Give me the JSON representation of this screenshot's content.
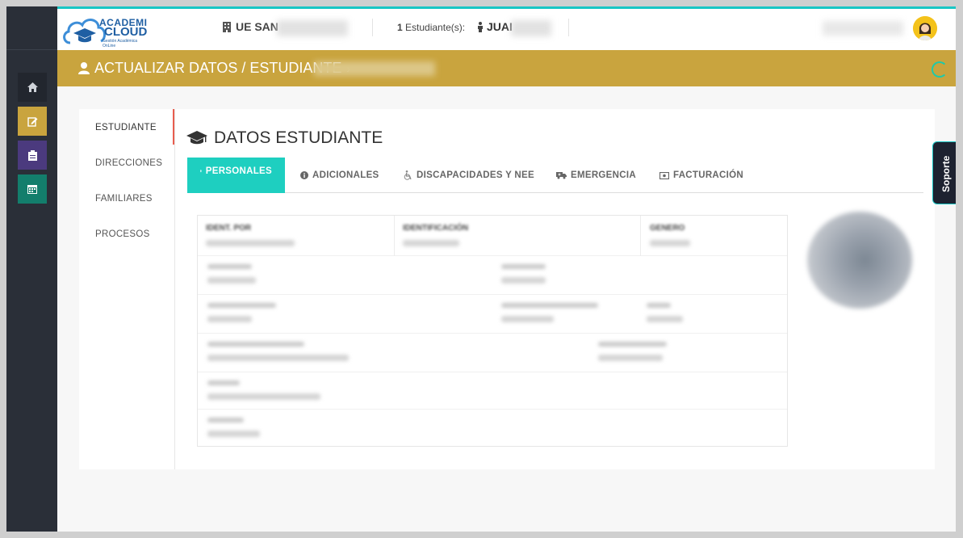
{
  "header": {
    "logo_line1": "ACADEMI",
    "logo_line2": "CLOUD",
    "logo_sub": "Gestión Académica OnLine",
    "school_name": "UE SAN",
    "student_count_number": "1",
    "student_count_label": "Estudiante(s):",
    "student_name": "JUAI"
  },
  "titlebar": {
    "title": "ACTUALIZAR DATOS / ESTUDIANTE",
    "separator": "›"
  },
  "left_nav": {
    "items": [
      {
        "label": "ESTUDIANTE"
      },
      {
        "label": "DIRECCIONES"
      },
      {
        "label": "FAMILIARES"
      },
      {
        "label": "PROCESOS"
      }
    ]
  },
  "section": {
    "title": "DATOS ESTUDIANTE"
  },
  "tabs": [
    {
      "label": "PERSONALES",
      "icon": "person-icon"
    },
    {
      "label": "ADICIONALES",
      "icon": "info-icon"
    },
    {
      "label": "DISCAPACIDADES Y NEE",
      "icon": "wheelchair-icon"
    },
    {
      "label": "EMERGENCIA",
      "icon": "ambulance-icon"
    },
    {
      "label": "FACTURACIÓN",
      "icon": "money-icon"
    }
  ],
  "form": {
    "header_labels": [
      "IDENT. POR",
      "IDENTIFICACIÓN",
      "GENERO"
    ]
  },
  "soporte_label": "Soporte",
  "colors": {
    "accent_teal": "#1ecfc0",
    "gold": "#c9a43e",
    "sidebar_dark": "#2a2f38",
    "btn_gold": "#c9a43e",
    "btn_purple": "#4b3a7e",
    "btn_teal": "#137e6c"
  }
}
